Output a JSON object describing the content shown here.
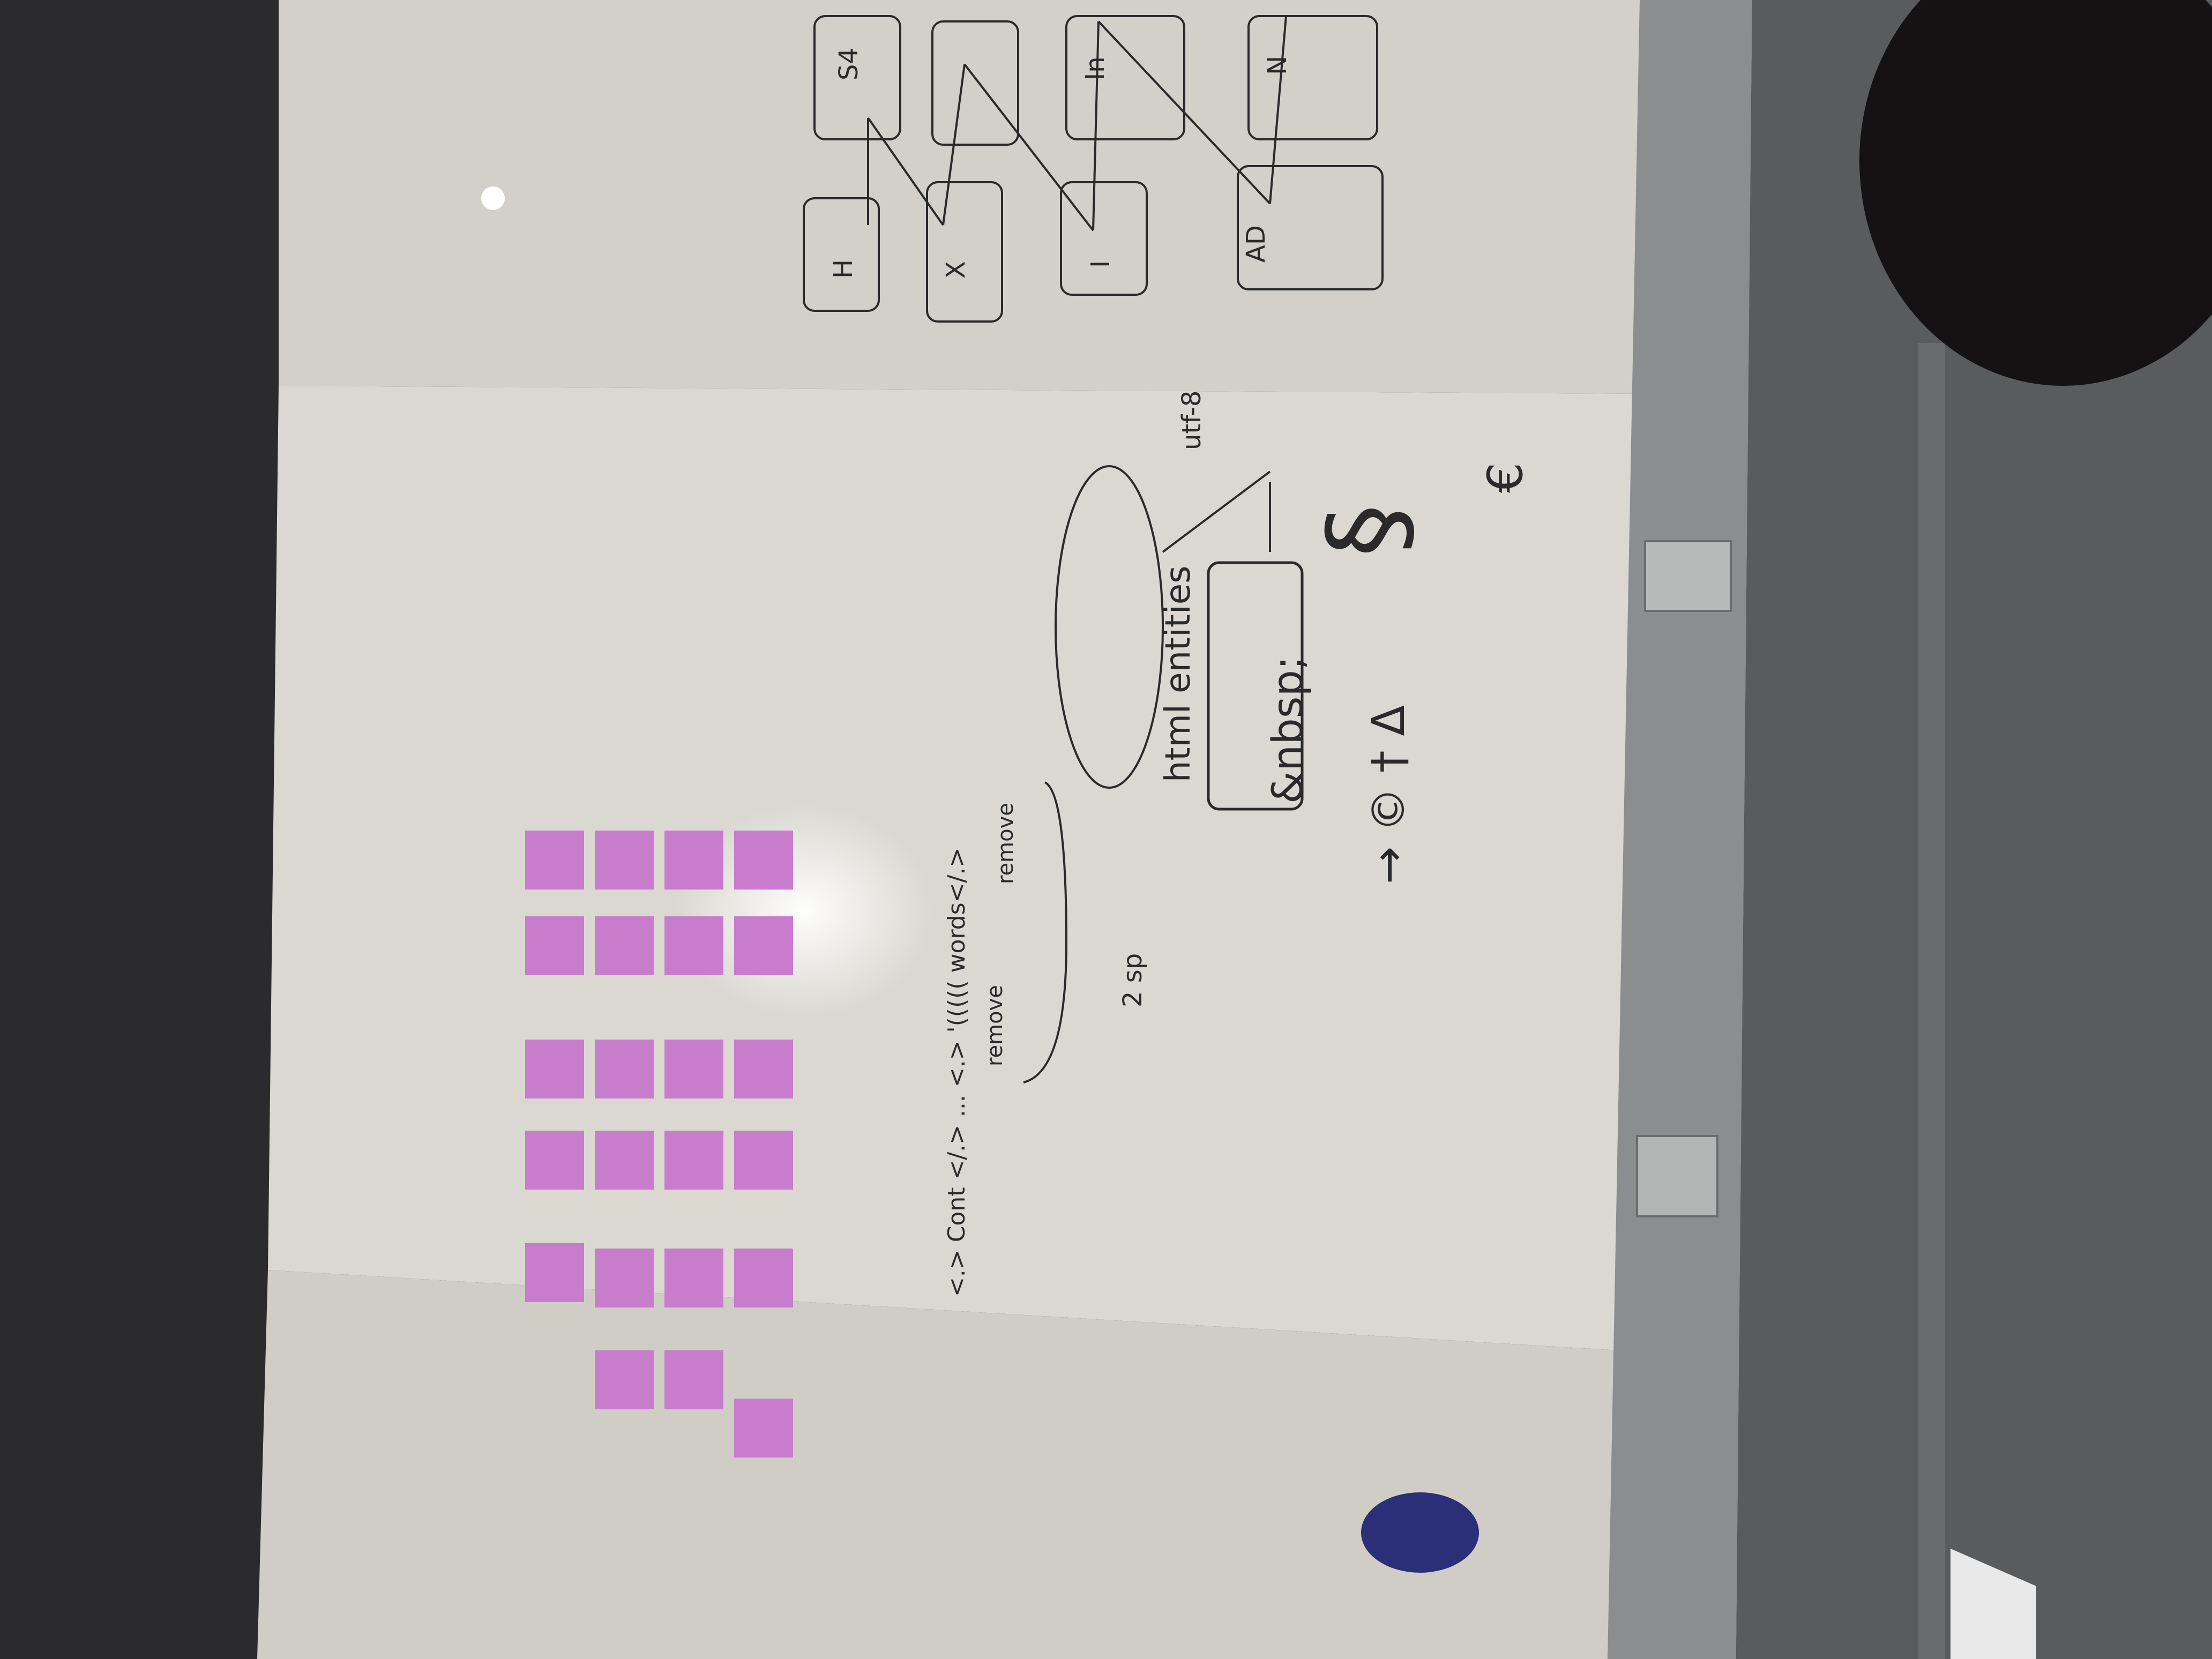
{
  "photo": {
    "subject": "whiteboard with sticky notes and handwriting",
    "colors": {
      "wall_dark": "#2f2f31",
      "board": "#d8d6cf",
      "board_shadow": "#bdbab2",
      "sticky": "#c77ccc",
      "marker": "#2a2a2a",
      "tray": "#8b8d8f",
      "eraser": "#2b2f78"
    }
  },
  "writing": {
    "cont_line": "<.> Cont </.> ... <.> '((((( words</.>",
    "remove_1": "remove",
    "remove_2": "remove",
    "two_sp": "2 sp",
    "html_entities": "html entities",
    "nbsp": "&nbsp;",
    "utf8": "utf-8",
    "symbols": "→ © † Δ",
    "section_sign": "§",
    "euro_like": "€"
  },
  "diagram": {
    "labels": [
      "H",
      "X",
      "I",
      "AD",
      "S4",
      "In",
      "N"
    ]
  },
  "sticky_notes": {
    "count": 23,
    "color": "#c77ccc"
  }
}
